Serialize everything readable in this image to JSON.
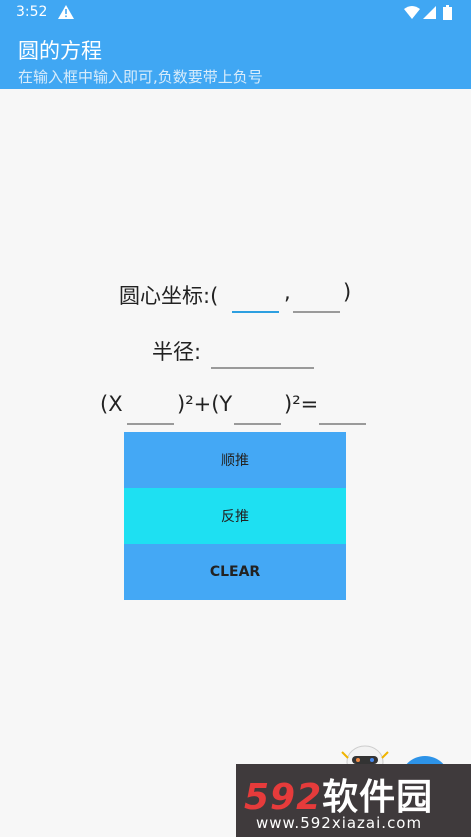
{
  "status_bar": {
    "time": "3:52"
  },
  "app_bar": {
    "title": "圆的方程",
    "subtitle": "在输入框中输入即可,负数要带上负号"
  },
  "center_row": {
    "label": "圆心坐标:(",
    "comma": ",",
    "close": ")"
  },
  "radius_row": {
    "label": "半径:"
  },
  "equation_row": {
    "x_open": "(X",
    "mid": ")²+(Y",
    "end": ")²="
  },
  "buttons": {
    "forward": "顺推",
    "reverse": "反推",
    "clear": "CLEAR"
  },
  "watermark": {
    "logo_num": "592",
    "logo_cn": "软件园",
    "url": "www.592xiazai.com"
  },
  "colors": {
    "primary": "#40a7f3",
    "accent_cyan": "#1ee0f2",
    "button_blue": "#44a8f5"
  }
}
